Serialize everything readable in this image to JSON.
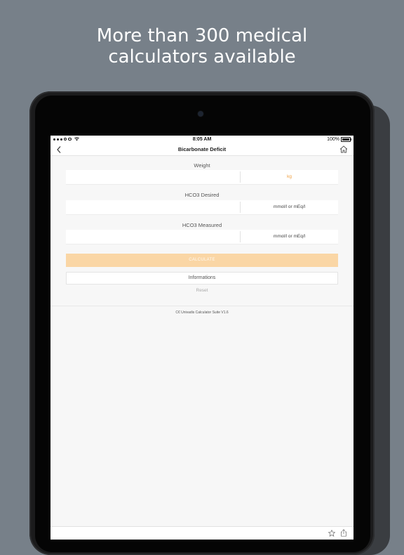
{
  "headline": {
    "line1": "More than 300 medical",
    "line2": "calculators available"
  },
  "status_bar": {
    "time": "8:05 AM",
    "battery": "100%"
  },
  "nav": {
    "title": "Bicarbonate Deficit",
    "back_icon": "chevron-left-icon",
    "home_icon": "home-icon"
  },
  "form": {
    "fields": [
      {
        "label": "Weight",
        "value": "",
        "unit": "kg"
      },
      {
        "label": "HCO3 Desired",
        "value": "",
        "unit": "mmol/l or mEq/l"
      },
      {
        "label": "HCO3 Measured",
        "value": "",
        "unit": "mmol/l or mEq/l"
      }
    ],
    "calculate_label": "CALCULATE",
    "info_label": "Informations",
    "reset_label": "Reset"
  },
  "footer": {
    "note": "C€ Univadis Calculator Suite V1.6"
  },
  "toolbar": {
    "icons": [
      "star-icon",
      "share-icon"
    ]
  },
  "colors": {
    "background": "#778089",
    "accent": "#f0a040",
    "button": "#fad6a5"
  }
}
